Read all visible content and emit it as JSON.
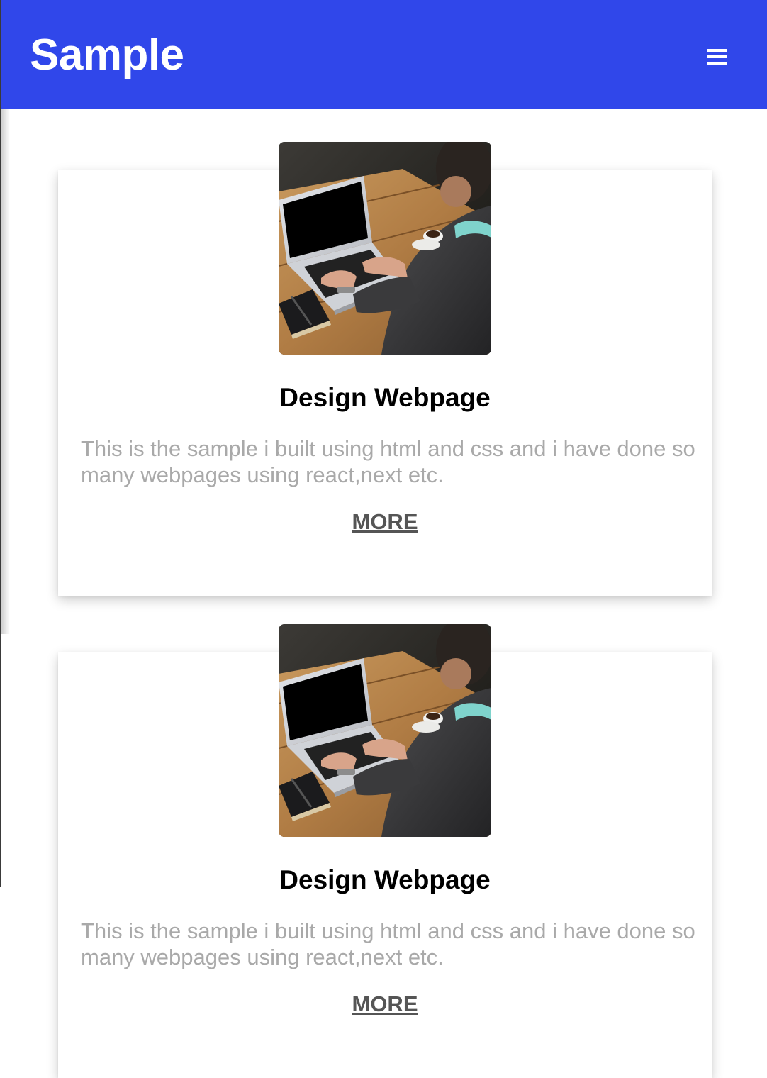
{
  "navbar": {
    "brand": "Sample",
    "menu_icon": "hamburger-menu-icon",
    "background": "#3047ea"
  },
  "cards": [
    {
      "image": "laptop-photo",
      "title": "Design Webpage",
      "text": "This is the sample i built using html and css and i have done so many webpages using react,next etc.",
      "link_label": "MORE"
    },
    {
      "image": "laptop-photo",
      "title": "Design Webpage",
      "text": "This is the sample i built using html and css and i have done so many webpages using react,next etc.",
      "link_label": "MORE"
    }
  ],
  "colors": {
    "title": "#000000",
    "body_text": "#a9a9a9",
    "link": "#555555"
  }
}
